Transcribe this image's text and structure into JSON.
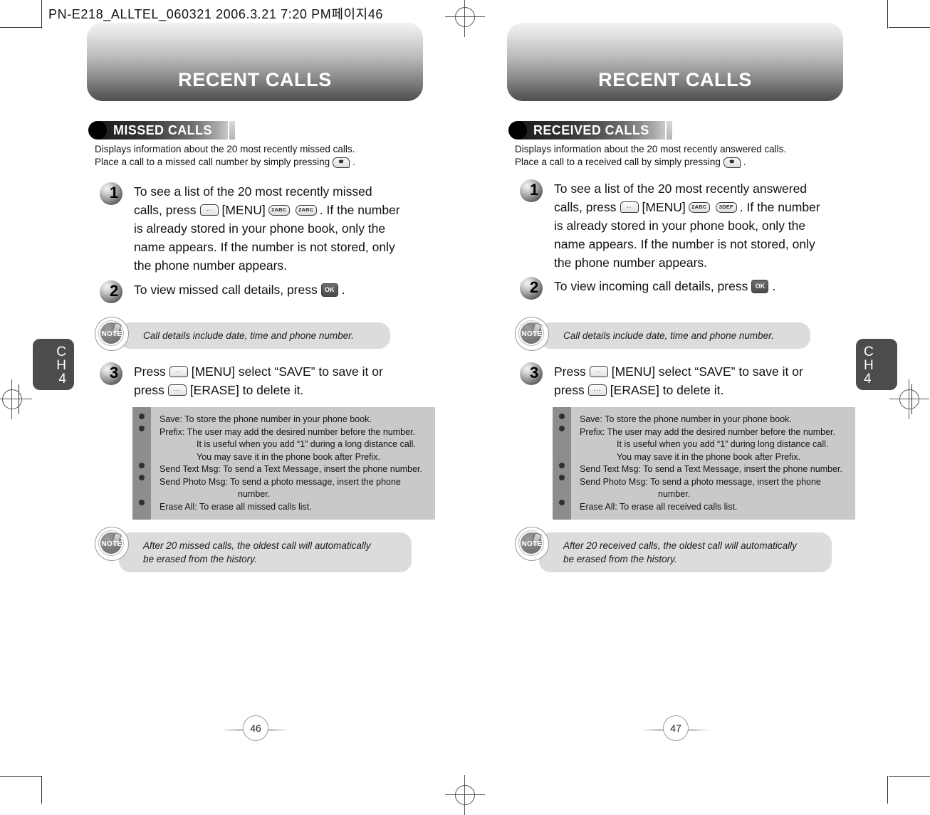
{
  "document": {
    "printer_header": "PN-E218_ALLTEL_060321  2006.3.21 7:20 PM페이지46"
  },
  "pages": [
    {
      "banner_title": "RECENT CALLS",
      "section_title": "MISSED CALLS",
      "intro": {
        "line1": "Displays information about the 20 most recently missed calls.",
        "line2_before": "Place a call to a missed call number by simply pressing",
        "line2_key": "SEND",
        "line2_after": "."
      },
      "steps": [
        {
          "number": "1",
          "seg1": "To see a list of the 20 most recently missed",
          "seg2_a": "calls, press",
          "seg2_key1": "MENU-SOFTKEY",
          "seg2_b": "[MENU]",
          "seg2_key2": "2ABC",
          "seg2_key3": "2ABC",
          "seg2_c": ". If the number",
          "seg3": "is already stored in your phone book, only the",
          "seg4": "name appears. If the number is not stored, only",
          "seg5": "the phone number appears."
        },
        {
          "number": "2",
          "seg1": "To view missed call details, press",
          "key": "OK",
          "seg2": "."
        },
        {
          "number": "3",
          "seg1_a": "Press",
          "key1": "MENU-SOFTKEY",
          "seg1_b": "[MENU] select “SAVE” to save it or",
          "seg2_a": "press",
          "key2": "ERASE-SOFTKEY",
          "seg2_b": "[ERASE] to delete it."
        }
      ],
      "note1": "Call details include date, time and phone number.",
      "bullets": [
        {
          "lines": [
            {
              "text": "Save: To store the phone number in your phone book.",
              "indent": 0
            }
          ]
        },
        {
          "lines": [
            {
              "text": "Prefix: The user may add the desired number before the number.",
              "indent": 0
            },
            {
              "text": "It is useful when you add “1” during a long distance call.",
              "indent": 1
            },
            {
              "text": "You may save it in the phone book after Prefix.",
              "indent": 1
            }
          ]
        },
        {
          "lines": [
            {
              "text": "Send Text Msg: To send a Text Message, insert the phone number.",
              "indent": 0
            }
          ]
        },
        {
          "lines": [
            {
              "text": "Send Photo Msg: To send a photo message, insert the phone",
              "indent": 0
            },
            {
              "text": "number.",
              "indent": 2
            }
          ]
        },
        {
          "lines": [
            {
              "text": "Erase All: To erase all missed calls list.",
              "indent": 0
            }
          ]
        }
      ],
      "note2_line1": "After 20 missed calls, the oldest call will automatically",
      "note2_line2": "be erased from the history.",
      "chapter_tab": {
        "ch": "C",
        "h": "H",
        "number": "4"
      },
      "folio": "46"
    },
    {
      "banner_title": "RECENT CALLS",
      "section_title": "RECEIVED CALLS",
      "intro": {
        "line1": "Displays information about the 20 most recently answered calls.",
        "line2_before": "Place a call to a received call by simply pressing",
        "line2_key": "SEND",
        "line2_after": "."
      },
      "steps": [
        {
          "number": "1",
          "seg1": "To see a list of the 20 most recently answered",
          "seg2_a": "calls, press",
          "seg2_key1": "MENU-SOFTKEY",
          "seg2_b": "[MENU]",
          "seg2_key2": "2ABC",
          "seg2_key3": "3DEF",
          "seg2_c": ". If the number",
          "seg3": "is already stored in your phone book, only the",
          "seg4": "name appears. If the number is not stored, only",
          "seg5": "the phone number appears."
        },
        {
          "number": "2",
          "seg1": "To view incoming call details, press",
          "key": "OK",
          "seg2": "."
        },
        {
          "number": "3",
          "seg1_a": "Press",
          "key1": "MENU-SOFTKEY",
          "seg1_b": "[MENU] select “SAVE” to save it or",
          "seg2_a": "press",
          "key2": "ERASE-SOFTKEY",
          "seg2_b": "[ERASE] to delete it."
        }
      ],
      "note1": "Call details include date, time and phone number.",
      "bullets": [
        {
          "lines": [
            {
              "text": "Save: To store the phone number in your phone book.",
              "indent": 0
            }
          ]
        },
        {
          "lines": [
            {
              "text": "Prefix: The user may add the desired number before the number.",
              "indent": 0
            },
            {
              "text": "It is useful when you add “1” during long distance call.",
              "indent": 1
            },
            {
              "text": "You may save it in the phone book after Prefix.",
              "indent": 1
            }
          ]
        },
        {
          "lines": [
            {
              "text": "Send Text Msg: To send a Text Message, insert the phone number.",
              "indent": 0
            }
          ]
        },
        {
          "lines": [
            {
              "text": "Send Photo Msg: To send a photo message, insert the phone",
              "indent": 0
            },
            {
              "text": "number.",
              "indent": 2
            }
          ]
        },
        {
          "lines": [
            {
              "text": "Erase All: To erase all received calls list.",
              "indent": 0
            }
          ]
        }
      ],
      "note2_line1": "After 20 received calls, the oldest call will automatically",
      "note2_line2": "be erased from the history.",
      "chapter_tab": {
        "ch": "C",
        "h": "H",
        "number": "4"
      },
      "folio": "47"
    }
  ],
  "key_labels": {
    "ok": "OK",
    "send": "SEND",
    "two_abc": "2ABC",
    "three_def": "3DEF",
    "soft_menu": "··",
    "soft_erase": "···"
  },
  "note_badge_label": "NOTE",
  "colors": {
    "banner_dark": "#4e4e4e",
    "banner_light": "#f2f2f2",
    "bullet_box": "#c9c9c9",
    "bullet_rail": "#8d8d8d",
    "note_bg": "#dcdcdc",
    "chapter_tab": "#4c4c4c"
  }
}
